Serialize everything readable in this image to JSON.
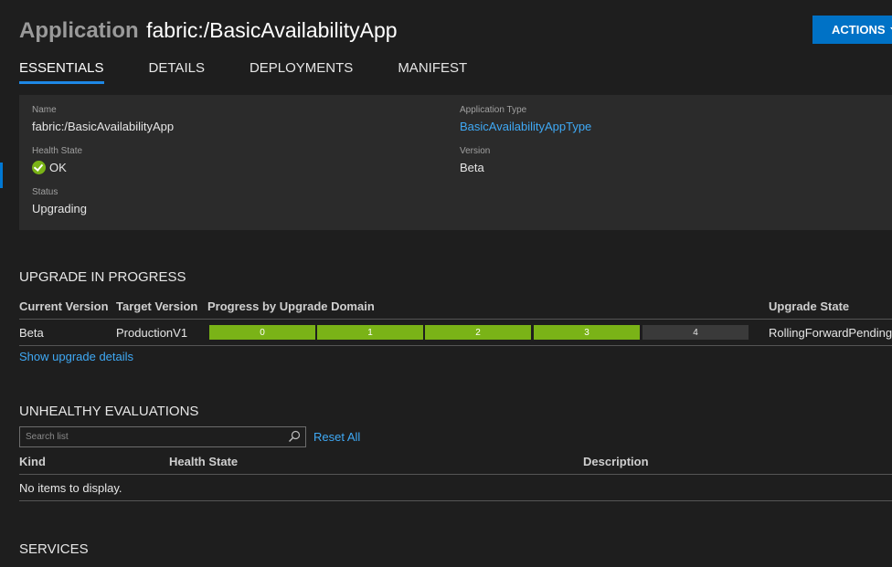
{
  "header": {
    "kind": "Application",
    "name": "fabric:/BasicAvailabilityApp",
    "actions_label": "ACTIONS"
  },
  "tabs": [
    {
      "label": "ESSENTIALS",
      "active": true
    },
    {
      "label": "DETAILS",
      "active": false
    },
    {
      "label": "DEPLOYMENTS",
      "active": false
    },
    {
      "label": "MANIFEST",
      "active": false
    }
  ],
  "essentials": {
    "name_label": "Name",
    "name_value": "fabric:/BasicAvailabilityApp",
    "health_label": "Health State",
    "health_value": "OK",
    "health_icon": "ok-check-icon",
    "status_label": "Status",
    "status_value": "Upgrading",
    "apptype_label": "Application Type",
    "apptype_value": "BasicAvailabilityAppType",
    "version_label": "Version",
    "version_value": "Beta"
  },
  "upgrade": {
    "title": "UPGRADE IN PROGRESS",
    "columns": [
      "Current Version",
      "Target Version",
      "Progress by Upgrade Domain",
      "Upgrade State"
    ],
    "row": {
      "current": "Beta",
      "target": "ProductionV1",
      "state": "RollingForwardPending"
    },
    "domains": [
      {
        "label": "0",
        "status": "completed"
      },
      {
        "label": "1",
        "status": "completed"
      },
      {
        "label": "2",
        "status": "completed"
      },
      {
        "label": "3",
        "status": "completed"
      },
      {
        "label": "4",
        "status": "pending"
      }
    ],
    "details_link": "Show upgrade details"
  },
  "unhealthy": {
    "title": "UNHEALTHY EVALUATIONS",
    "search_placeholder": "Search list",
    "reset_label": "Reset All",
    "columns": [
      "Kind",
      "Health State",
      "Description"
    ],
    "empty_text": "No items to display."
  },
  "services": {
    "title": "SERVICES"
  },
  "colors": {
    "accent": "#0072c6",
    "ok": "#7ab317",
    "link": "#3fa9f5",
    "panel": "#2b2b2b",
    "background": "#1e1e1e"
  }
}
